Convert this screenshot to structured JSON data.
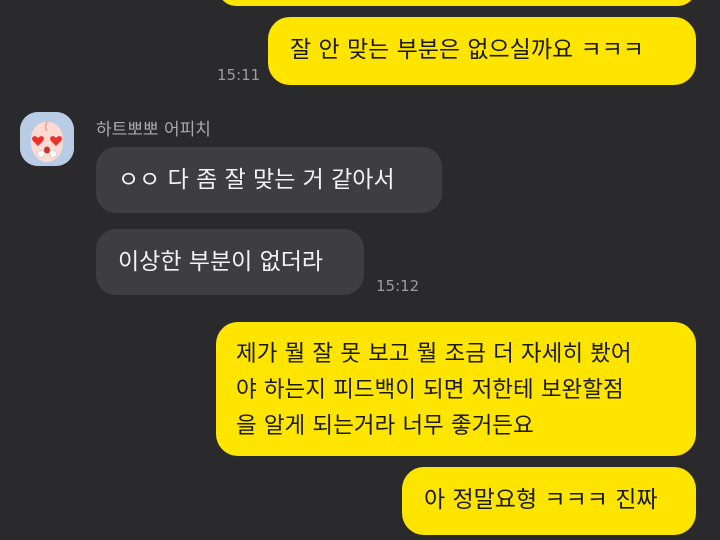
{
  "messages": {
    "m0_partial": "",
    "m1": "잘 안 맞는 부분은 없으실까요 ㅋㅋㅋ",
    "m1_time": "15:11",
    "sender_name": "하트뽀뽀 어피치",
    "m2": "ㅇㅇ 다 좀 잘 맞는 거 같아서",
    "m3": "이상한 부분이 없더라",
    "m3_time": "15:12",
    "m4": "제가 뭘 잘 못 보고 뭘 조금 더 자세히 봤어\n야 하는지 피드백이 되면 저한테 보완할점\n을 알게 되는거라 너무 좋거든요",
    "m5": "아 정말요형 ㅋㅋㅋ 진짜"
  },
  "colors": {
    "background": "#2a2a2c",
    "my_bubble": "#fee500",
    "other_bubble": "#3e3e41",
    "avatar_bg": "#b8cce6"
  },
  "icons": {
    "avatar": "apeach-heart-eyes-avatar"
  }
}
